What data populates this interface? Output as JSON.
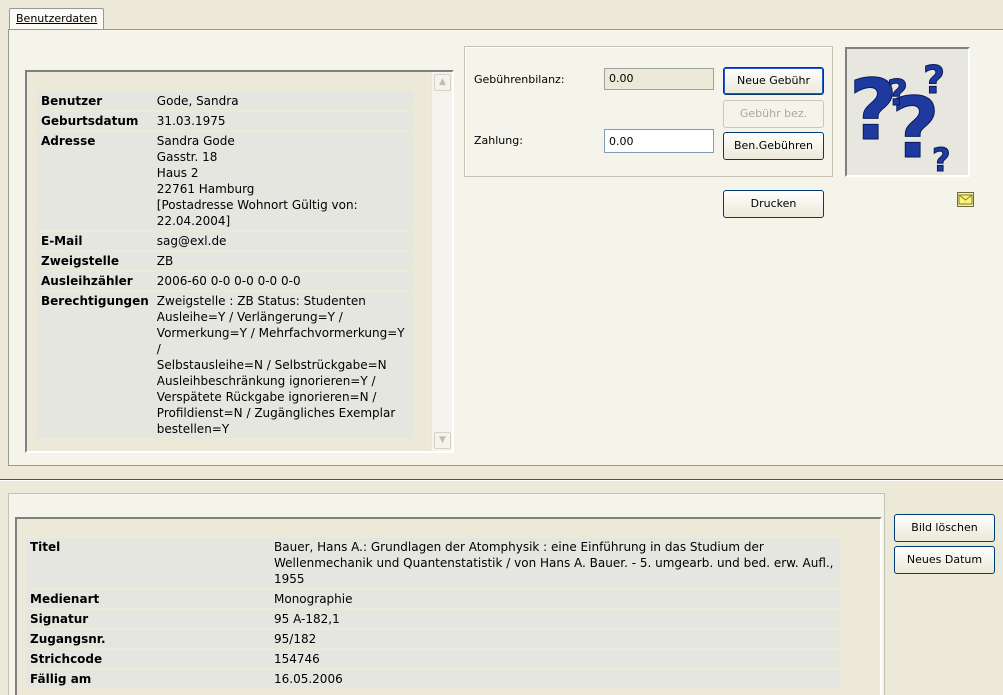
{
  "tab": {
    "label": "Benutzerdaten"
  },
  "user": {
    "rows": [
      {
        "key": "Benutzer",
        "value": "Gode, Sandra"
      },
      {
        "key": "Geburtsdatum",
        "value": "31.03.1975"
      },
      {
        "key": "Adresse",
        "value": "Sandra Gode\nGasstr. 18\nHaus 2\n22761 Hamburg\n[Postadresse Wohnort Gültig von:\n22.04.2004]"
      },
      {
        "key": "E-Mail",
        "value": "sag@exl.de"
      },
      {
        "key": "Zweigstelle",
        "value": "ZB"
      },
      {
        "key": "Ausleihzähler",
        "value": "2006-60 0-0 0-0 0-0 0-0"
      },
      {
        "key": "Berechtigungen",
        "value": "Zweigstelle : ZB Status: Studenten\nAusleihe=Y / Verlängerung=Y /\nVormerkung=Y / Mehrfachvormerkung=Y /\nSelbstausleihe=N / Selbstrückgabe=N\nAusleihbeschränkung ignorieren=Y /\nVerspätete Rückgabe ignorieren=N /\nProfildienst=N / Zugängliches Exemplar\nbestellen=Y"
      }
    ]
  },
  "fees": {
    "balance_label": "Gebührenbilanz:",
    "balance_value": "0.00",
    "payment_label": "Zahlung:",
    "payment_value": "0.00",
    "new_fee_button": "Neue Gebühr",
    "pay_fee_button": "Gebühr bez.",
    "user_fees_button": "Ben.Gebühren",
    "print_button": "Drucken"
  },
  "image": {
    "icon": "question-marks-placeholder",
    "color": "#1e3a9e"
  },
  "media": {
    "rows": [
      {
        "key": "Titel",
        "value": "Bauer, Hans A.: Grundlagen der Atomphysik : eine Einführung in das Studium der Wellenmechanik und Quantenstatistik / von Hans A. Bauer. - 5. umgearb. und bed. erw. Aufl., 1955"
      },
      {
        "key": "Medienart",
        "value": "Monographie"
      },
      {
        "key": "Signatur",
        "value": "95 A-182,1"
      },
      {
        "key": "Zugangsnr.",
        "value": "95/182"
      },
      {
        "key": "Strichcode",
        "value": "154746"
      },
      {
        "key": "Fällig am",
        "value": "16.05.2006"
      }
    ],
    "delete_image_button": "Bild löschen",
    "new_date_button": "Neues Datum"
  }
}
